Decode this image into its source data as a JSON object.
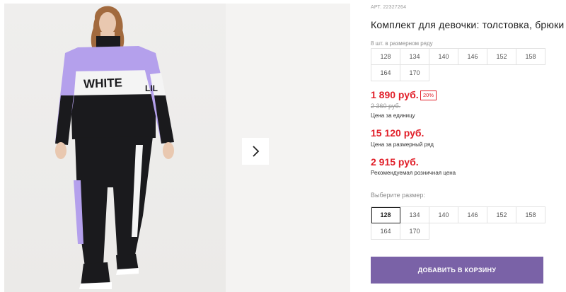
{
  "gallery": {
    "photo_text_front": "WHITE",
    "photo_text_side": "LIL"
  },
  "product": {
    "art_label": "АРТ.",
    "art_value": "22327264",
    "title": "Комплект для девочки: толстовка, брюки",
    "pack_label": "8 шт. в размерном ряду",
    "pack_sizes": [
      "128",
      "134",
      "140",
      "146",
      "152",
      "158",
      "164",
      "170"
    ]
  },
  "pricing": {
    "price": "1 890 руб.",
    "discount": "20%",
    "old_price": "2 360 руб.",
    "unit_label": "Цена за единицу",
    "row_price": "15 120 руб.",
    "row_label": "Цена за размерный ряд",
    "rrp_price": "2 915 руб.",
    "rrp_label": "Рекомендуемая розничная цена"
  },
  "size_select": {
    "label": "Выберите размер:",
    "sizes": [
      "128",
      "134",
      "140",
      "146",
      "152",
      "158",
      "164",
      "170"
    ],
    "selected": "128"
  },
  "cart": {
    "button_label": "ДОБАВИТЬ В КОРЗИНУ"
  },
  "colors": {
    "price_red": "#e1202a",
    "button_purple": "#7a62a7",
    "lilac": "#b4a0ec",
    "black": "#1a1a1d"
  },
  "icons": {
    "next": "chevron-right-icon"
  }
}
